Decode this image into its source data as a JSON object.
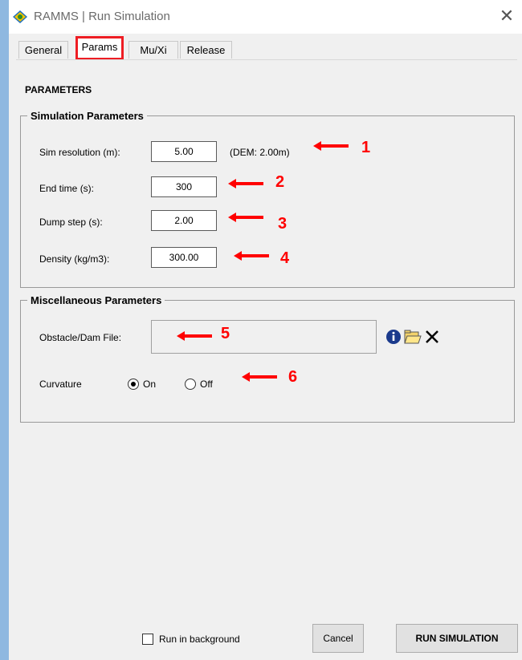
{
  "window": {
    "title": "RAMMS | Run Simulation",
    "app_icon": "ramms-logo-icon",
    "close_icon": "close-icon"
  },
  "tabs": [
    {
      "label": "General",
      "active": false
    },
    {
      "label": "Params",
      "active": true
    },
    {
      "label": "Mu/Xi",
      "active": false
    },
    {
      "label": "Release",
      "active": false
    }
  ],
  "params": {
    "heading": "PARAMETERS",
    "simulation": {
      "legend": "Simulation Parameters",
      "sim_resolution": {
        "label": "Sim resolution (m):",
        "value": "5.00",
        "note": "(DEM: 2.00m)"
      },
      "end_time": {
        "label": "End time (s):",
        "value": "300"
      },
      "dump_step": {
        "label": "Dump step (s):",
        "value": "2.00"
      },
      "density": {
        "label": "Density (kg/m3):",
        "value": "300.00"
      }
    },
    "misc": {
      "legend": "Miscellaneous Parameters",
      "obstacle": {
        "label": "Obstacle/Dam File:",
        "value": ""
      },
      "buttons": [
        "info-icon",
        "open-folder-icon",
        "delete-x-icon"
      ],
      "curvature": {
        "label": "Curvature",
        "on": "On",
        "off": "Off",
        "selected": "On"
      }
    }
  },
  "annotations": [
    "1",
    "2",
    "3",
    "4",
    "5",
    "6"
  ],
  "annotation_color": "#ff0000",
  "bottom": {
    "run_in_background": {
      "label": "Run in background",
      "checked": false
    },
    "cancel": "Cancel",
    "run": "RUN SIMULATION"
  }
}
